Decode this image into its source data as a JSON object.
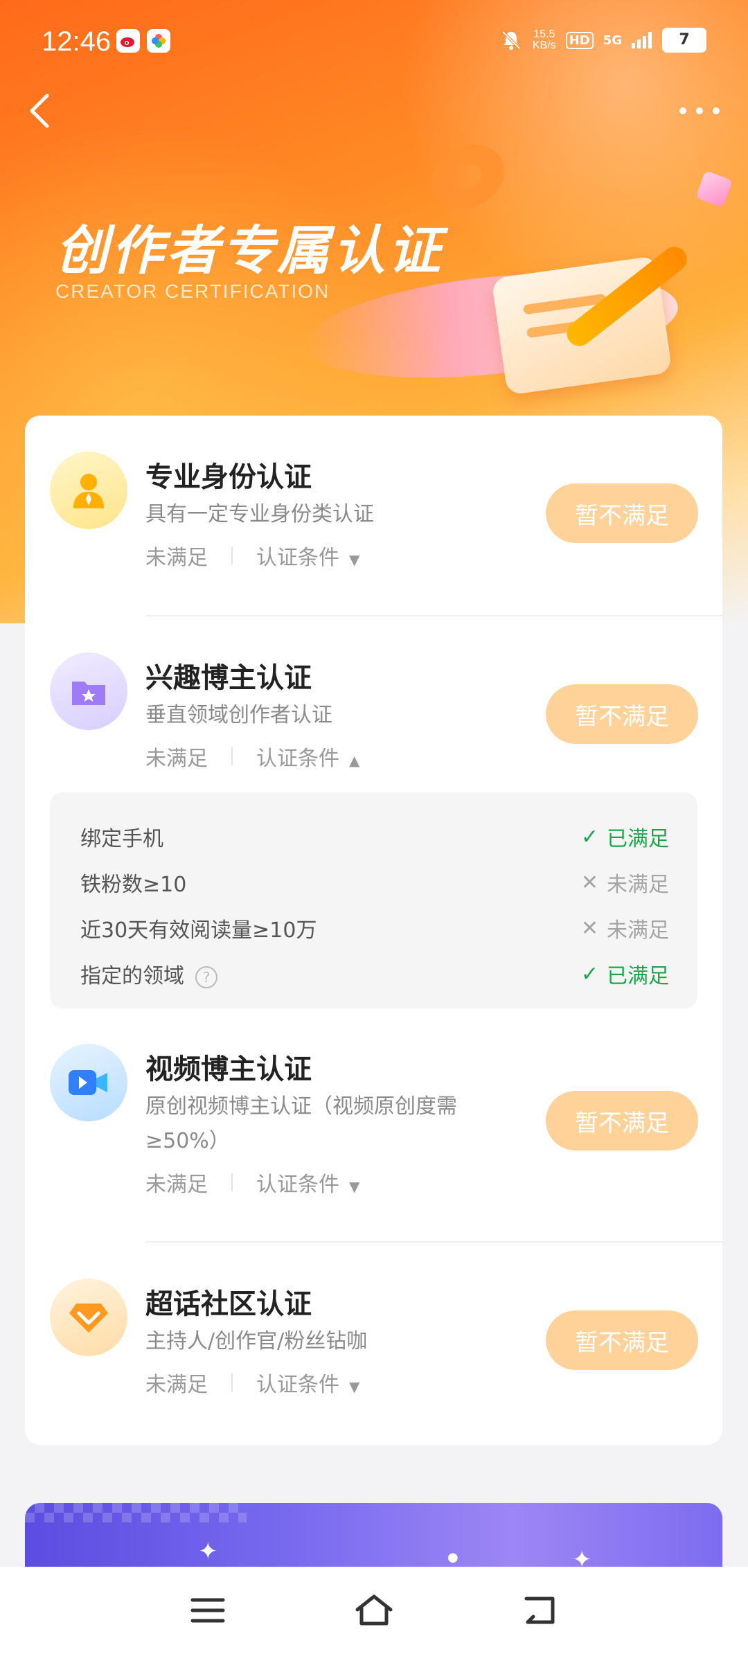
{
  "status_bar": {
    "time": "12:46",
    "net_speed_value": "15.5",
    "net_speed_unit": "KB/s",
    "hd": "HD",
    "signal": "5G",
    "battery": "7"
  },
  "hero": {
    "title": "创作者专属认证",
    "subtitle": "CREATOR CERTIFICATION"
  },
  "certifications": [
    {
      "title": "专业身份认证",
      "description": "具有一定专业身份类认证",
      "status": "未满足",
      "conditions_label": "认证条件",
      "button": "暂不满足",
      "icon": "person-icon"
    },
    {
      "title": "兴趣博主认证",
      "description": "垂直领域创作者认证",
      "status": "未满足",
      "conditions_label": "认证条件",
      "button": "暂不满足",
      "icon": "folder-star-icon",
      "expanded": true,
      "conditions": [
        {
          "label": "绑定手机",
          "state": "已满足",
          "met": true
        },
        {
          "label": "铁粉数≥10",
          "state": "未满足",
          "met": false
        },
        {
          "label": "近30天有效阅读量≥10万",
          "state": "未满足",
          "met": false
        },
        {
          "label": "指定的领域",
          "state": "已满足",
          "met": true
        }
      ]
    },
    {
      "title": "视频博主认证",
      "description_line1": "原创视频博主认证（视频原创度需",
      "description_line2": "≥50%）",
      "status": "未满足",
      "conditions_label": "认证条件",
      "button": "暂不满足",
      "icon": "video-camera-icon"
    },
    {
      "title": "超话社区认证",
      "description": "主持人/创作官/粉丝钻咖",
      "status": "未满足",
      "conditions_label": "认证条件",
      "button": "暂不满足",
      "icon": "diamond-icon"
    }
  ],
  "colors": {
    "button_bg": "#ffd29a",
    "met": "#19a74a",
    "unmet": "#a5a5a5",
    "hero_orange": "#ff6a1a"
  }
}
